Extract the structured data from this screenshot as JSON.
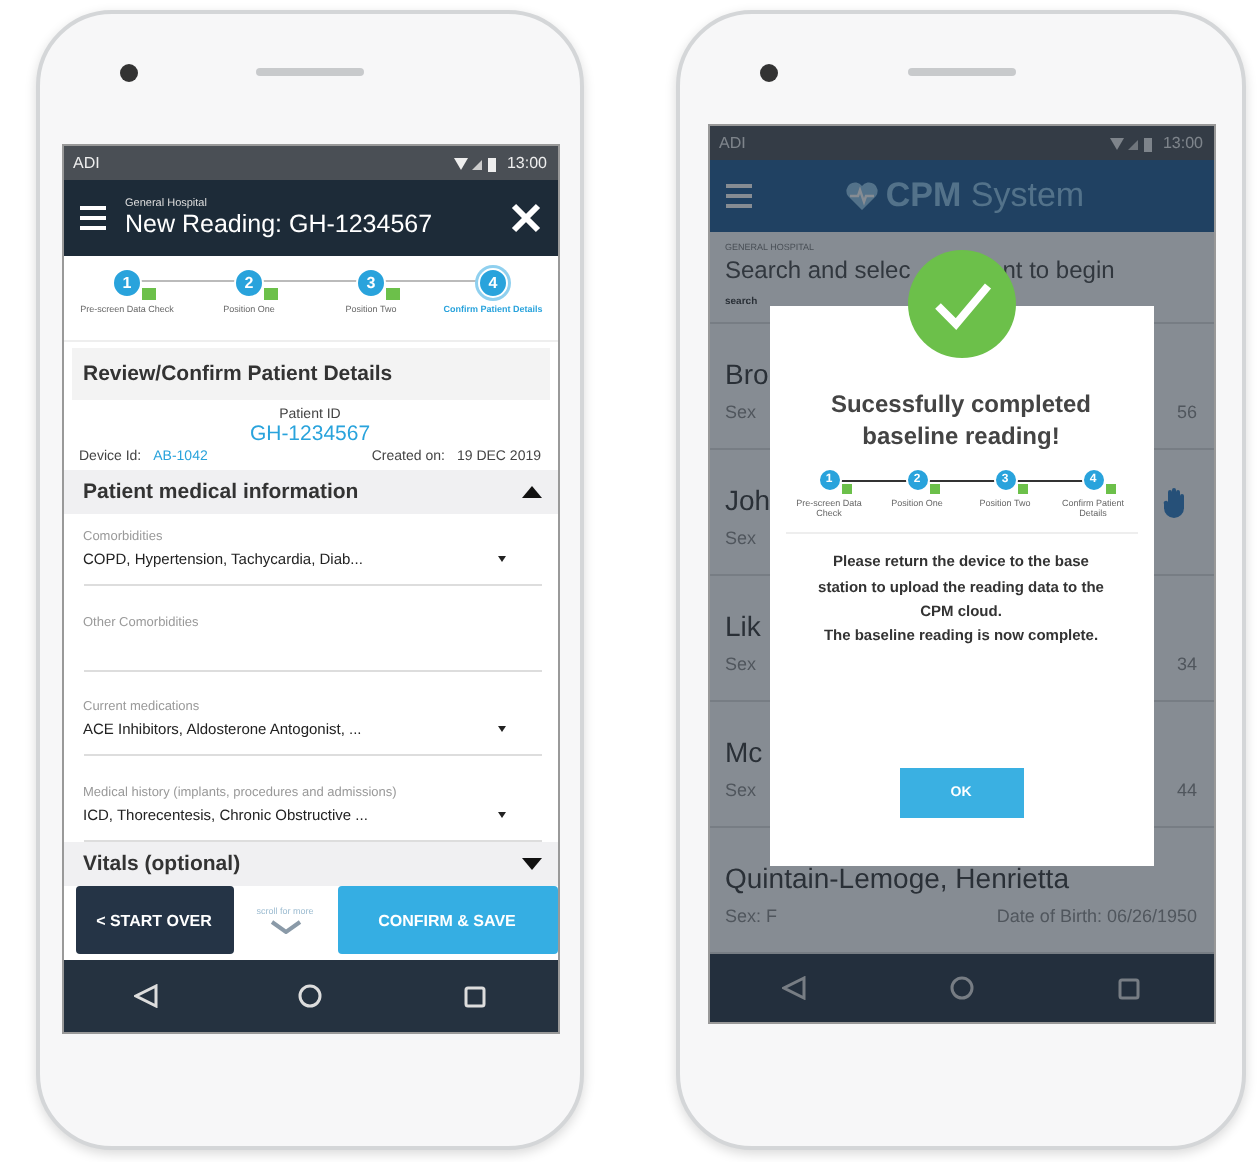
{
  "left_phone": {
    "status_bar": {
      "carrier": "ADI",
      "time": "13:00"
    },
    "app_bar": {
      "subtitle": "General Hospital",
      "title": "New Reading: GH-1234567"
    },
    "steps": [
      {
        "number": "1",
        "label": "Pre-screen Data Check",
        "completed": true,
        "selected": false
      },
      {
        "number": "2",
        "label": "Position One",
        "completed": true,
        "selected": false
      },
      {
        "number": "3",
        "label": "Position Two",
        "completed": true,
        "selected": false
      },
      {
        "number": "4",
        "label": "Confirm Patient Details",
        "completed": false,
        "selected": true
      }
    ],
    "page_title": "Review/Confirm Patient Details",
    "patient": {
      "id_label": "Patient ID",
      "id": "GH-1234567",
      "device_label": "Device Id:",
      "device": "AB-1042",
      "created_label": "Created on:",
      "created": "19 DEC 2019"
    },
    "sections": [
      {
        "title": "Patient medical information",
        "expanded": true,
        "fields": [
          {
            "kind": "dropdown",
            "label": "Comorbidities",
            "value": "COPD, Hypertension, Tachycardia, Diab..."
          },
          {
            "kind": "text",
            "label": "Other Comorbidities"
          },
          {
            "kind": "dropdown",
            "label": "Current medications",
            "value": "ACE Inhibitors, Aldosterone Antogonist, ..."
          },
          {
            "kind": "dropdown",
            "label": "Medical history (implants, procedures and admissions)",
            "value": "ICD, Thorecentesis, Chronic Obstructive ..."
          }
        ]
      },
      {
        "title": "Vitals (optional)",
        "expanded": false
      }
    ],
    "buttons": {
      "start_over": "< START OVER",
      "scroll_hint": "scroll for more",
      "confirm": "CONFIRM & SAVE"
    }
  },
  "right_phone": {
    "status_bar": {
      "carrier": "ADI",
      "time": "13:00"
    },
    "app_bar": {
      "title_bold": "CPM",
      "title": "System"
    },
    "search": {
      "label": "GENERAL HOSPITAL",
      "title_start": "Search and selec",
      "title_end": "nt to begin",
      "placeholder": "search"
    },
    "patients": [
      {
        "name": "Bro",
        "sex": "Sex",
        "dob": "56",
        "flagged": false
      },
      {
        "name": "Joh",
        "sex": "Sex",
        "flagged": true
      },
      {
        "name": "Lik",
        "sex": "Sex",
        "dob": "34",
        "flagged": false
      },
      {
        "name": "Mc",
        "sex": "Sex",
        "dob": "44",
        "flagged": false
      },
      {
        "name": "Quintain-Lemoge, Henrietta",
        "sex": "Sex: F",
        "dob": "Date of Birth: 06/26/1950",
        "flagged": false
      }
    ],
    "modal": {
      "title": "Sucessfully completed baseline reading!",
      "steps": [
        {
          "number": "1",
          "label": "Pre-screen Data Check",
          "completed": true,
          "selected": false
        },
        {
          "number": "2",
          "label": "Position One",
          "completed": true,
          "selected": false
        },
        {
          "number": "3",
          "label": "Position Two",
          "completed": true,
          "selected": false
        },
        {
          "number": "4",
          "label": "Confirm Patient Details",
          "completed": true,
          "selected": false
        }
      ],
      "message": [
        "Please return the device to the base station to upload the reading data to the CPM cloud.",
        "The baseline reading is now complete."
      ],
      "button": "OK"
    }
  }
}
